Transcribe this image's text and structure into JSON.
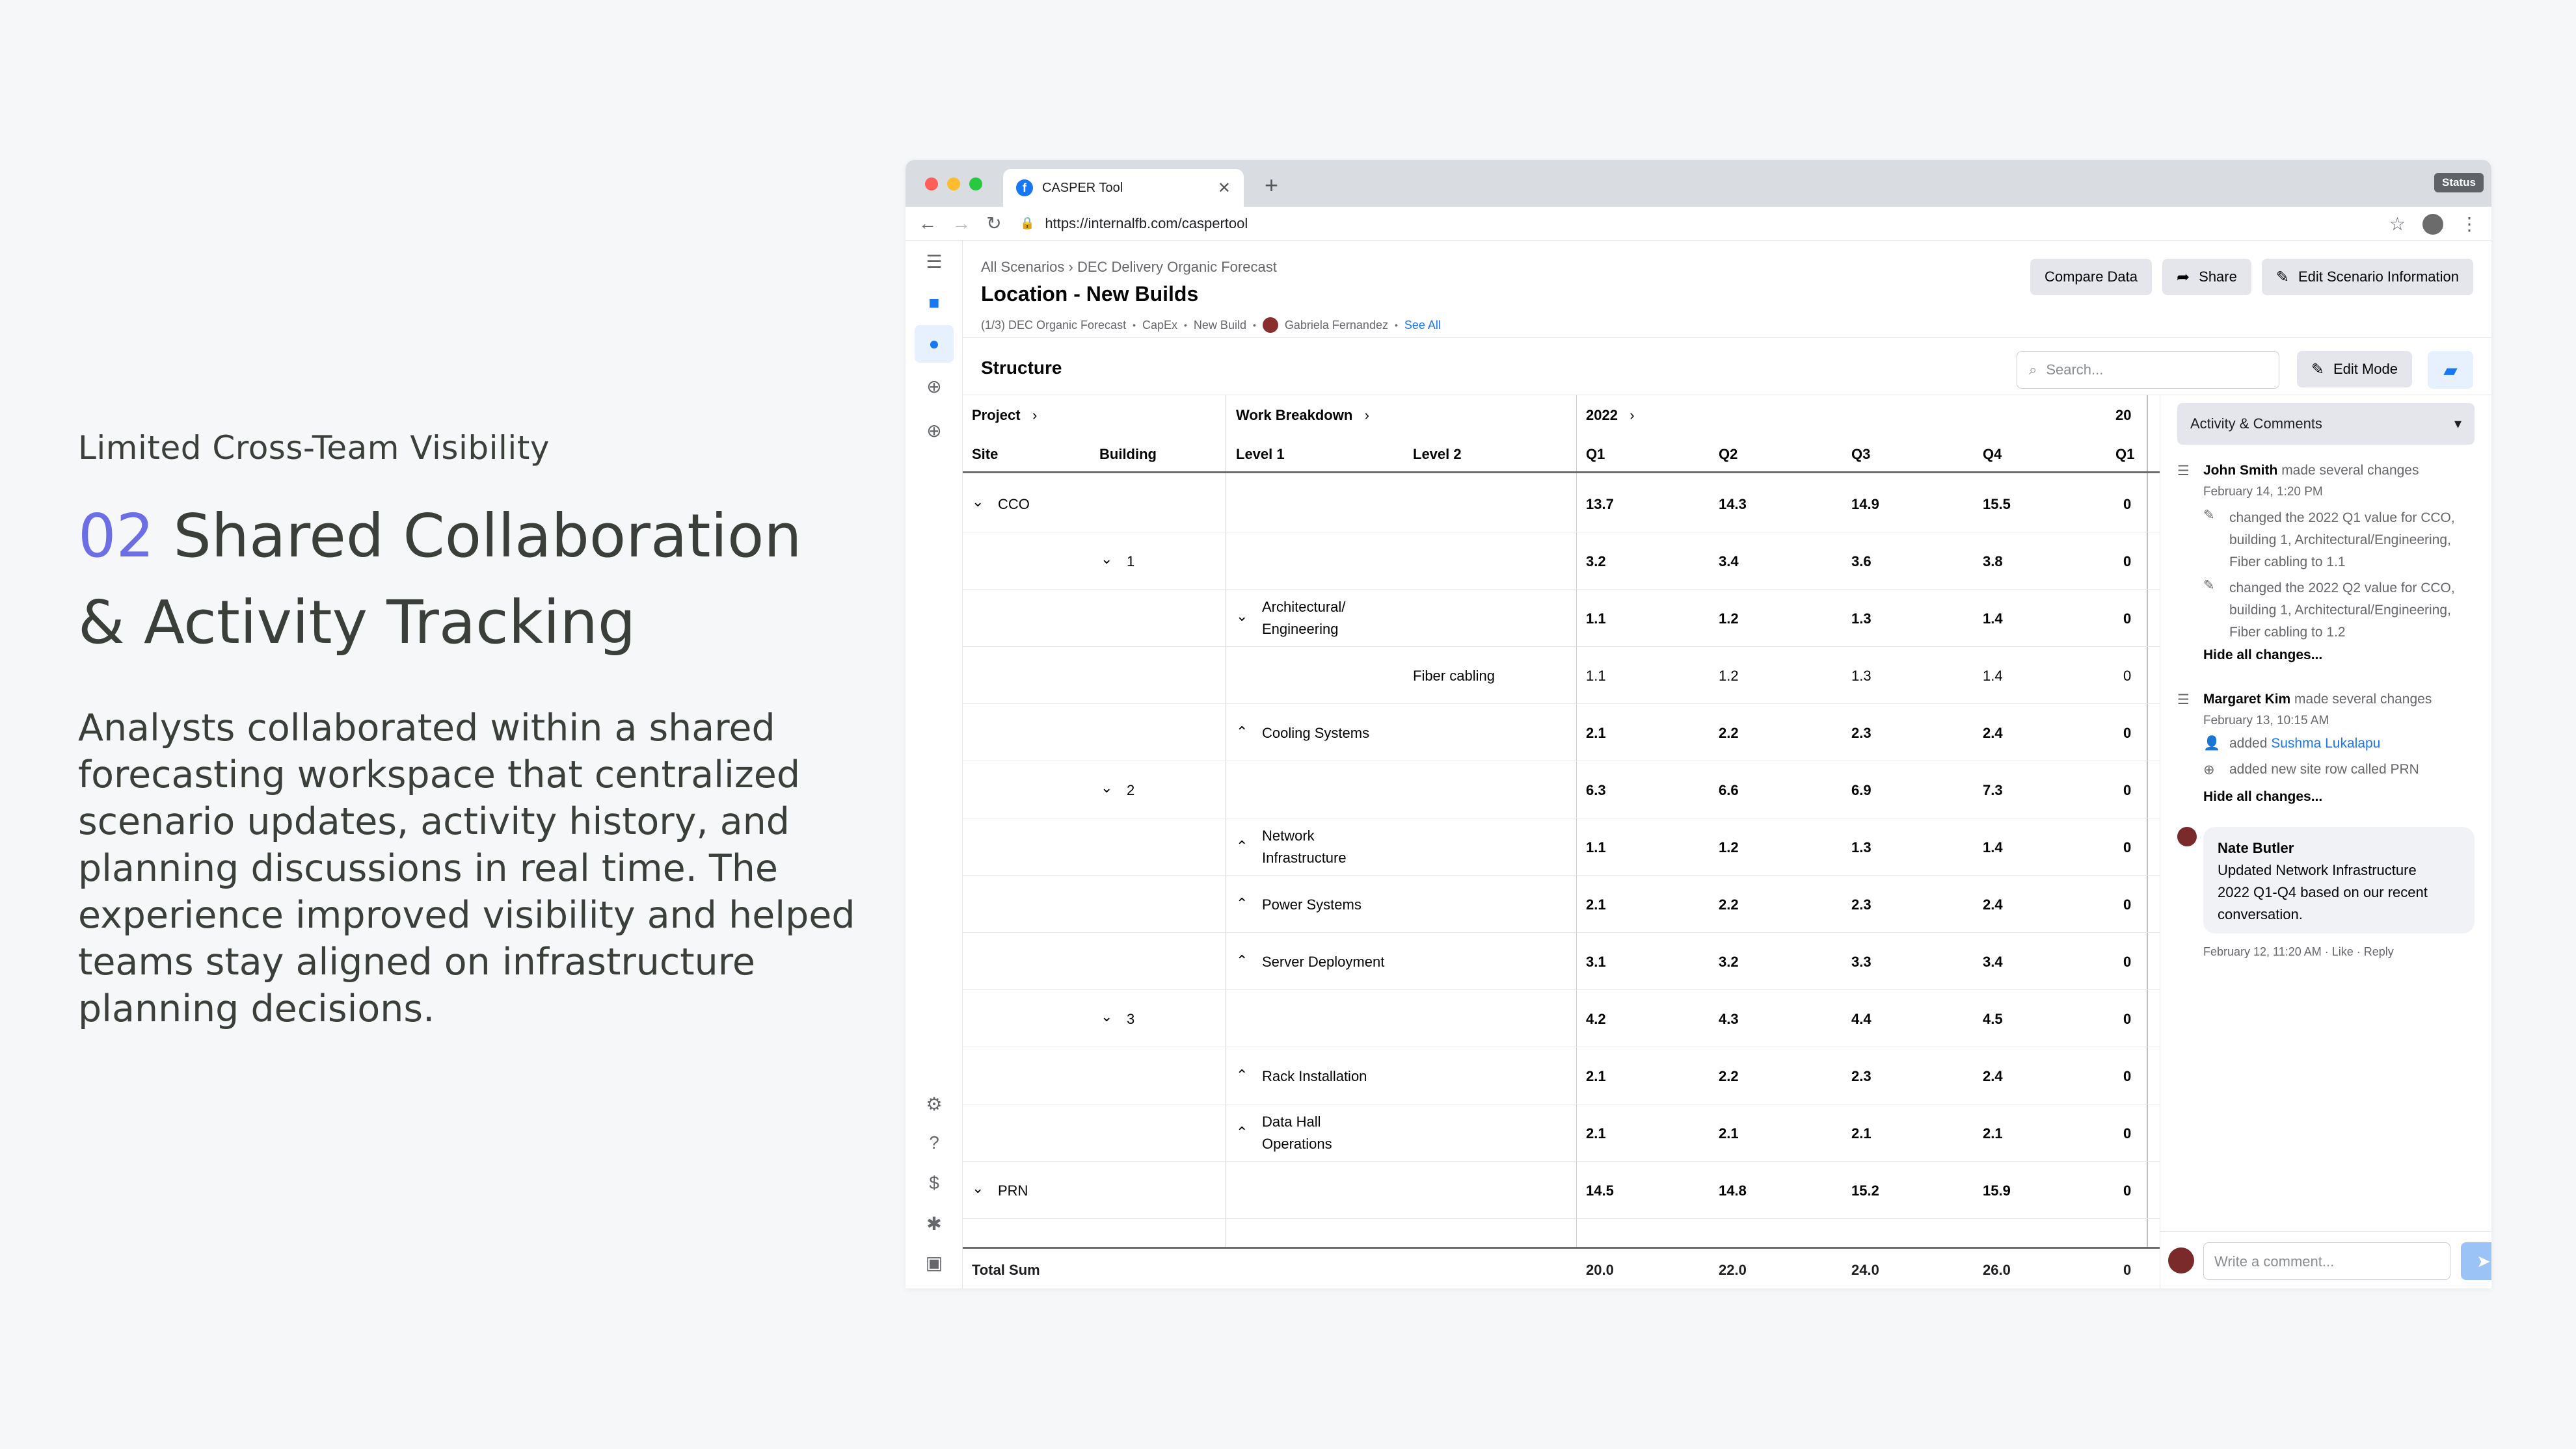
{
  "copy": {
    "eyebrow": "Limited Cross-Team Visibility",
    "number": "02",
    "headline_1": "Shared Collaboration",
    "headline_2": "& Activity Tracking",
    "body": "Analysts collaborated within a shared forecasting workspace that centralized scenario updates, activity history, and planning discussions in real time. The experience improved visibility and helped teams stay aligned on infrastructure planning decisions."
  },
  "browser": {
    "tab_title": "CASPER Tool",
    "url": "https://internalfb.com/caspertool",
    "status": "Status"
  },
  "page": {
    "crumb_1": "All Scenarios",
    "crumb_2": "DEC Delivery Organic Forecast",
    "title": "Location - New Builds",
    "meta_1": "(1/3) DEC Organic Forecast",
    "meta_2": "CapEx",
    "meta_3": "New Build",
    "meta_user": "Gabriela Fernandez",
    "meta_link": "See All",
    "btn_compare": "Compare Data",
    "btn_share": "Share",
    "btn_edit_info": "Edit Scenario Information"
  },
  "structure": {
    "title": "Structure",
    "search_placeholder": "Search...",
    "edit_mode": "Edit Mode"
  },
  "grid": {
    "group_project": "Project",
    "group_work": "Work Breakdown",
    "group_year": "2022",
    "group_next": "20",
    "col_site": "Site",
    "col_building": "Building",
    "col_level1": "Level 1",
    "col_level2": "Level 2",
    "col_q1": "Q1",
    "col_q2": "Q2",
    "col_q3": "Q3",
    "col_q4": "Q4",
    "col_next_q1": "Q1",
    "rows": [
      {
        "site": "CCO",
        "q1": "13.7",
        "q2": "14.3",
        "q3": "14.9",
        "q4": "15.5",
        "nq1": "0"
      },
      {
        "building": "1",
        "q1": "3.2",
        "q2": "3.4",
        "q3": "3.6",
        "q4": "3.8",
        "nq1": "0"
      },
      {
        "level1_a": "Architectural/",
        "level1_b": "Engineering",
        "q1": "1.1",
        "q2": "1.2",
        "q3": "1.3",
        "q4": "1.4",
        "nq1": "0"
      },
      {
        "level2": "Fiber cabling",
        "q1": "1.1",
        "q2": "1.2",
        "q3": "1.3",
        "q4": "1.4",
        "nq1": "0"
      },
      {
        "level1": "Cooling Systems",
        "q1": "2.1",
        "q2": "2.2",
        "q3": "2.3",
        "q4": "2.4",
        "nq1": "0"
      },
      {
        "building": "2",
        "q1": "6.3",
        "q2": "6.6",
        "q3": "6.9",
        "q4": "7.3",
        "nq1": "0"
      },
      {
        "level1_a": "Network",
        "level1_b": "Infrastructure",
        "q1": "1.1",
        "q2": "1.2",
        "q3": "1.3",
        "q4": "1.4",
        "nq1": "0"
      },
      {
        "level1": "Power Systems",
        "q1": "2.1",
        "q2": "2.2",
        "q3": "2.3",
        "q4": "2.4",
        "nq1": "0"
      },
      {
        "level1": "Server Deployment",
        "q1": "3.1",
        "q2": "3.2",
        "q3": "3.3",
        "q4": "3.4",
        "nq1": "0"
      },
      {
        "building": "3",
        "q1": "4.2",
        "q2": "4.3",
        "q3": "4.4",
        "q4": "4.5",
        "nq1": "0"
      },
      {
        "level1": "Rack Installation",
        "q1": "2.1",
        "q2": "2.2",
        "q3": "2.3",
        "q4": "2.4",
        "nq1": "0"
      },
      {
        "level1_a": "Data Hall",
        "level1_b": "Operations",
        "q1": "2.1",
        "q2": "2.1",
        "q3": "2.1",
        "q4": "2.1",
        "nq1": "0"
      },
      {
        "site": "PRN",
        "q1": "14.5",
        "q2": "14.8",
        "q3": "15.2",
        "q4": "15.9",
        "nq1": "0"
      }
    ],
    "total_label": "Total Sum",
    "total_q1": "20.0",
    "total_q2": "22.0",
    "total_q3": "24.0",
    "total_q4": "26.0",
    "total_nq1": "0"
  },
  "activity": {
    "dropdown": "Activity & Comments",
    "a1_name": "John Smith",
    "a1_action": "made several changes",
    "a1_time": "February 14, 1:20 PM",
    "a1_c1_l1": "changed the 2022 Q1 value for CCO,",
    "a1_c1_l2": "building 1, Architectural/Engineering,",
    "a1_c1_l3": "Fiber cabling to 1.1",
    "a1_c2_l1": "changed the 2022 Q2 value for CCO,",
    "a1_c2_l2": "building 1, Architectural/Engineering,",
    "a1_c2_l3": "Fiber cabling to 1.2",
    "a1_hide": "Hide all changes...",
    "a2_name": "Margaret Kim",
    "a2_action": "made several changes",
    "a2_time": "February 13, 10:15 AM",
    "a2_c1_pre": "added",
    "a2_c1_user": "Sushma Lukalapu",
    "a2_c2": "added new site row called PRN",
    "a2_hide": "Hide all changes...",
    "c_name": "Nate Butler",
    "c_l1": "Updated Network Infrastructure",
    "c_l2": "2022 Q1-Q4 based on our recent",
    "c_l3": "conversation.",
    "c_meta": "February 12, 11:20 AM · Like · Reply",
    "composer_placeholder": "Write a comment..."
  }
}
